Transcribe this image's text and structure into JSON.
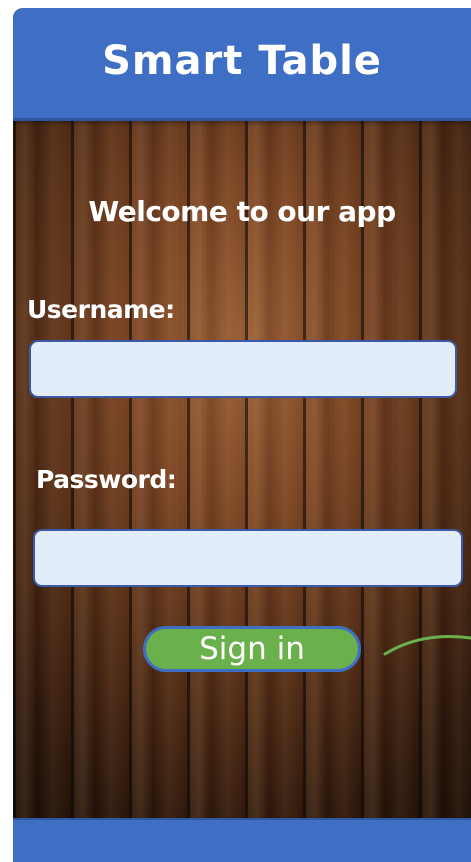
{
  "header": {
    "title": "Smart Table"
  },
  "main": {
    "welcome": "Welcome to our app",
    "username_label": "Username:",
    "username_value": "",
    "password_label": "Password:",
    "password_value": "",
    "signin_label": "Sign in"
  },
  "colors": {
    "header": "#3f6fc4",
    "field_background": "#e3ecf9",
    "field_border": "#3a5aa8",
    "signin_button": "#6ab04c",
    "arrow": "#6ab04c"
  }
}
